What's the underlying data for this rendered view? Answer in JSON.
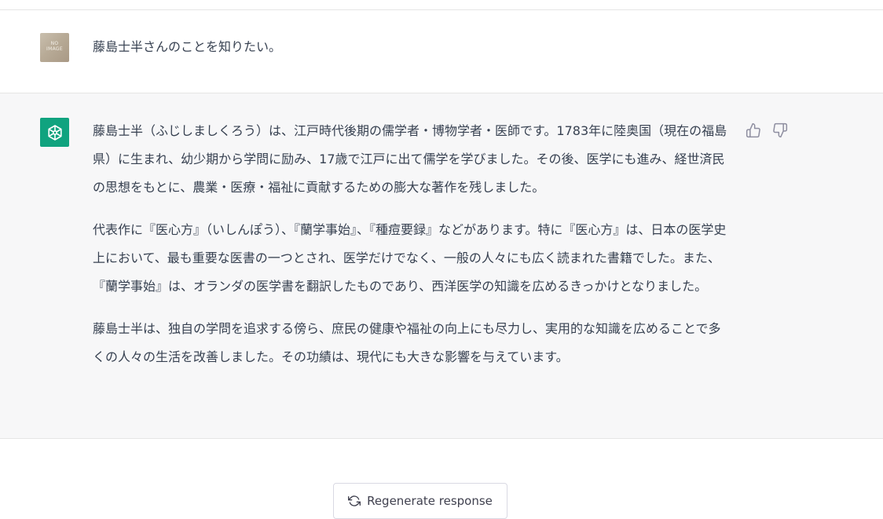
{
  "user_message": {
    "avatar_text": "NO\nIMAGE",
    "text": "藤島士半さんのことを知りたい。"
  },
  "assistant_message": {
    "paragraphs": [
      "藤島士半（ふじしましくろう）は、江戸時代後期の儒学者・博物学者・医師です。1783年に陸奥国（現在の福島県）に生まれ、幼少期から学問に励み、17歳で江戸に出て儒学を学びました。その後、医学にも進み、経世済民の思想をもとに、農業・医療・福祉に貢献するための膨大な著作を残しました。",
      "代表作に『医心方』（いしんぽう）、『蘭学事始』、『種痘要録』などがあります。特に『医心方』は、日本の医学史上において、最も重要な医書の一つとされ、医学だけでなく、一般の人々にも広く読まれた書籍でした。また、『蘭学事始』は、オランダの医学書を翻訳したものであり、西洋医学の知識を広めるきっかけとなりました。",
      "藤島士半は、独自の学問を追求する傍ら、庶民の健康や福祉の向上にも尽力し、実用的な知識を広めることで多くの人々の生活を改善しました。その功績は、現代にも大きな影響を与えています。"
    ]
  },
  "feedback": {
    "thumb_up_icon": "thumbs-up-icon",
    "thumb_down_icon": "thumbs-down-icon"
  },
  "regenerate": {
    "label": "Regenerate response",
    "icon": "refresh-icon"
  },
  "colors": {
    "accent": "#10a37f",
    "assistant_bg": "#f7f7f8",
    "text": "#374151"
  }
}
